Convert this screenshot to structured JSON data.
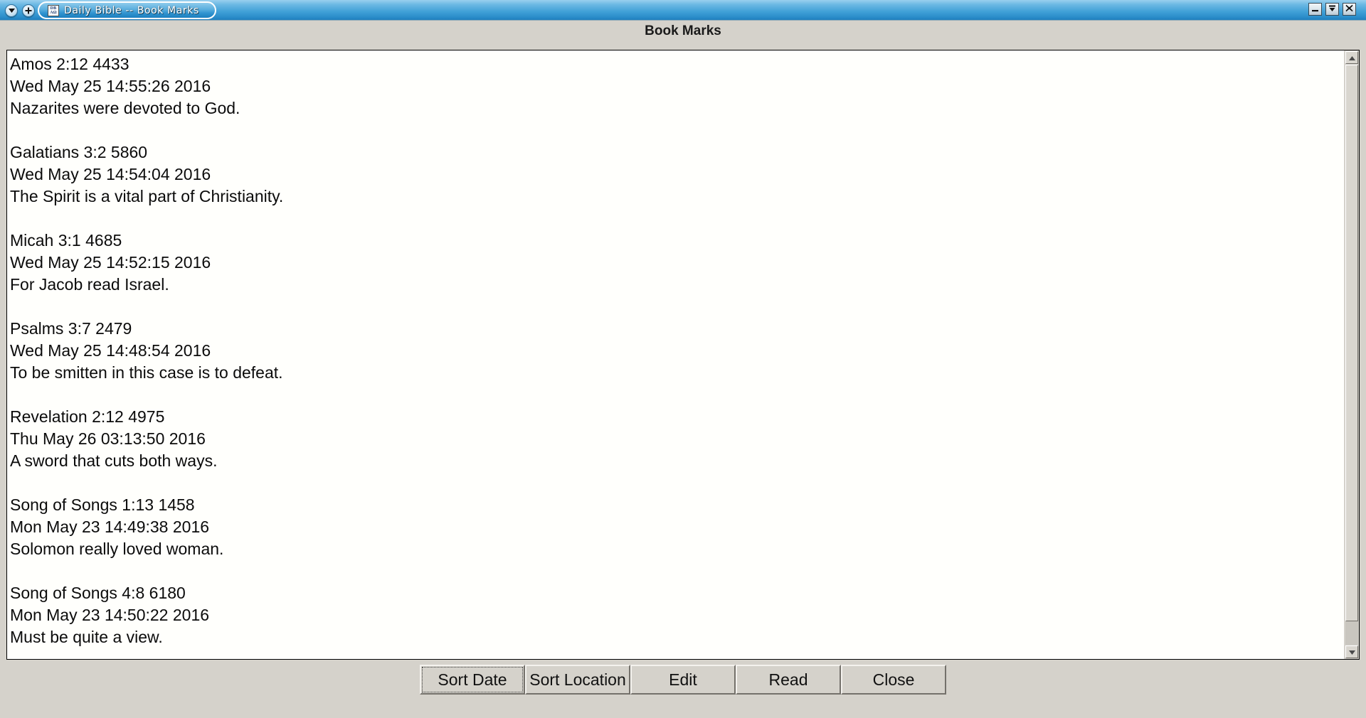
{
  "window": {
    "title": "Daily Bible -- Book Marks",
    "app_icon_line1": "DB",
    "app_icon_line2": "AΩ",
    "menu_icon": "chevron-down-icon",
    "shade_icon": "plus-icon",
    "minimize_icon": "minimize-icon",
    "maximize_icon": "maximize-icon",
    "close_icon": "close-icon"
  },
  "header": {
    "title": "Book Marks"
  },
  "bookmarks": [
    {
      "location": "Amos 2:12 4433",
      "timestamp": "Wed May 25 14:55:26 2016",
      "note": "Nazarites were devoted to God."
    },
    {
      "location": "Galatians 3:2 5860",
      "timestamp": "Wed May 25 14:54:04 2016",
      "note": "The Spirit is a vital part of Christianity."
    },
    {
      "location": "Micah 3:1 4685",
      "timestamp": "Wed May 25 14:52:15 2016",
      "note": "For Jacob read Israel."
    },
    {
      "location": "Psalms 3:7 2479",
      "timestamp": "Wed May 25 14:48:54 2016",
      "note": "To be smitten in this case is to defeat."
    },
    {
      "location": "Revelation 2:12 4975",
      "timestamp": "Thu May 26 03:13:50 2016",
      "note": "A sword that cuts both ways."
    },
    {
      "location": "Song of Songs 1:13 1458",
      "timestamp": "Mon May 23 14:49:38 2016",
      "note": "Solomon really loved woman."
    },
    {
      "location": "Song of Songs 4:8 6180",
      "timestamp": "Mon May 23 14:50:22 2016",
      "note": "Must be quite a view."
    }
  ],
  "scrollbar": {
    "up_icon": "scroll-up-icon",
    "down_icon": "scroll-down-icon",
    "thumb_position": "top"
  },
  "buttons": {
    "sort_date": "Sort Date",
    "sort_location": "Sort Location",
    "edit": "Edit",
    "read": "Read",
    "close": "Close"
  },
  "colors": {
    "window_background": "#d5d2cb",
    "titlebar_accent": "#2f93cf",
    "text_background": "#fffffc",
    "text_color": "#0b0b0b"
  }
}
